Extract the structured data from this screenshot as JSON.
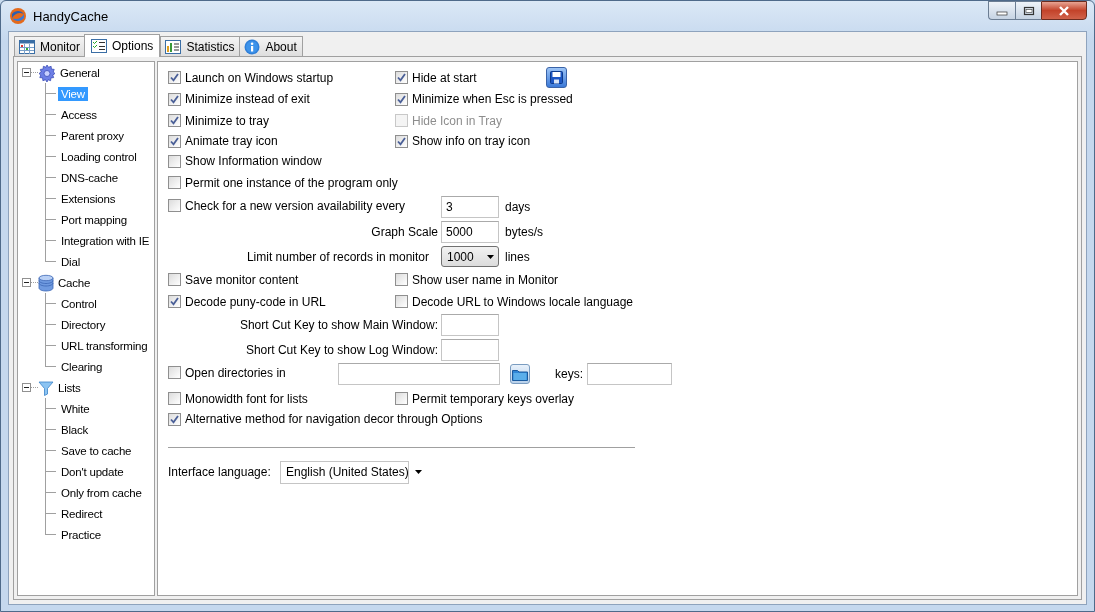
{
  "window": {
    "title": "HandyCache"
  },
  "tabs": [
    {
      "label": "Monitor",
      "selected": false
    },
    {
      "label": "Options",
      "selected": true
    },
    {
      "label": "Statistics",
      "selected": false
    },
    {
      "label": "About",
      "selected": false
    }
  ],
  "tree": [
    {
      "label": "General",
      "expanded": true,
      "children": [
        {
          "label": "View",
          "selected": true
        },
        {
          "label": "Access",
          "selected": false
        },
        {
          "label": "Parent proxy",
          "selected": false
        },
        {
          "label": "Loading control",
          "selected": false
        },
        {
          "label": "DNS-cache",
          "selected": false
        },
        {
          "label": "Extensions",
          "selected": false
        },
        {
          "label": "Port mapping",
          "selected": false
        },
        {
          "label": "Integration with IE",
          "selected": false
        },
        {
          "label": "Dial",
          "selected": false
        }
      ]
    },
    {
      "label": "Cache",
      "expanded": true,
      "children": [
        {
          "label": "Control",
          "selected": false
        },
        {
          "label": "Directory",
          "selected": false
        },
        {
          "label": "URL transforming",
          "selected": false
        },
        {
          "label": "Clearing",
          "selected": false
        }
      ]
    },
    {
      "label": "Lists",
      "expanded": true,
      "children": [
        {
          "label": "White",
          "selected": false
        },
        {
          "label": "Black",
          "selected": false
        },
        {
          "label": "Save to cache",
          "selected": false
        },
        {
          "label": "Don't update",
          "selected": false
        },
        {
          "label": "Only from cache",
          "selected": false
        },
        {
          "label": "Redirect",
          "selected": false
        },
        {
          "label": "Practice",
          "selected": false
        }
      ]
    }
  ],
  "options": [
    {
      "kind": "pair-save",
      "left": {
        "label": "Launch on Windows startup",
        "checked": true,
        "disabled": false
      },
      "right": {
        "label": "Hide at start",
        "checked": true,
        "disabled": false
      }
    },
    {
      "kind": "pair",
      "left": {
        "label": "Minimize instead of exit",
        "checked": true,
        "disabled": false
      },
      "right": {
        "label": "Minimize when Esc is pressed",
        "checked": true,
        "disabled": false
      }
    },
    {
      "kind": "pair",
      "left": {
        "label": "Minimize to tray",
        "checked": true,
        "disabled": false
      },
      "right": {
        "label": "Hide Icon in Tray",
        "checked": false,
        "disabled": true
      }
    },
    {
      "kind": "pair",
      "left": {
        "label": "Animate tray icon",
        "checked": true,
        "disabled": false
      },
      "right": {
        "label": "Show info on tray icon",
        "checked": true,
        "disabled": false
      }
    },
    {
      "kind": "pair",
      "left": {
        "label": "Show Information window",
        "checked": false,
        "disabled": false
      }
    },
    {
      "kind": "pair",
      "left": {
        "label": "Permit one instance of the program only",
        "checked": false,
        "disabled": false
      }
    },
    {
      "kind": "check-field",
      "left": {
        "label": "Check for a new version availability every",
        "checked": false,
        "disabled": false
      },
      "value": "3",
      "unit": "days"
    },
    {
      "kind": "field",
      "label": "Graph Scale",
      "value": "5000",
      "unit": "bytes/s"
    },
    {
      "kind": "select",
      "label": "Limit number of records in monitor",
      "value": "1000",
      "unit": "lines"
    },
    {
      "kind": "pair",
      "left": {
        "label": "Save monitor content",
        "checked": false,
        "disabled": false
      },
      "right": {
        "label": "Show user name in Monitor",
        "checked": false,
        "disabled": false
      }
    },
    {
      "kind": "pair",
      "left": {
        "label": "Decode puny-code in URL",
        "checked": true,
        "disabled": false
      },
      "right": {
        "label": "Decode URL to Windows locale language",
        "checked": false,
        "disabled": false
      }
    },
    {
      "kind": "field",
      "label": "Short Cut Key to show Main Window:"
    },
    {
      "kind": "field",
      "label": "Short Cut Key to show Log Window:"
    },
    {
      "kind": "path",
      "left": {
        "label": "Open directories in",
        "checked": false,
        "disabled": false
      },
      "keys_label": "keys:"
    },
    {
      "kind": "pair",
      "left": {
        "label": "Monowidth font for lists",
        "checked": false,
        "disabled": false
      },
      "right": {
        "label": "Permit temporary keys overlay",
        "checked": false,
        "disabled": false
      }
    },
    {
      "kind": "pair",
      "left": {
        "label": "Alternative method for navigation decor through Options",
        "checked": true,
        "disabled": false
      }
    },
    {
      "kind": "separator"
    },
    {
      "kind": "language",
      "label": "Interface language:",
      "value": "English (United States)"
    }
  ]
}
